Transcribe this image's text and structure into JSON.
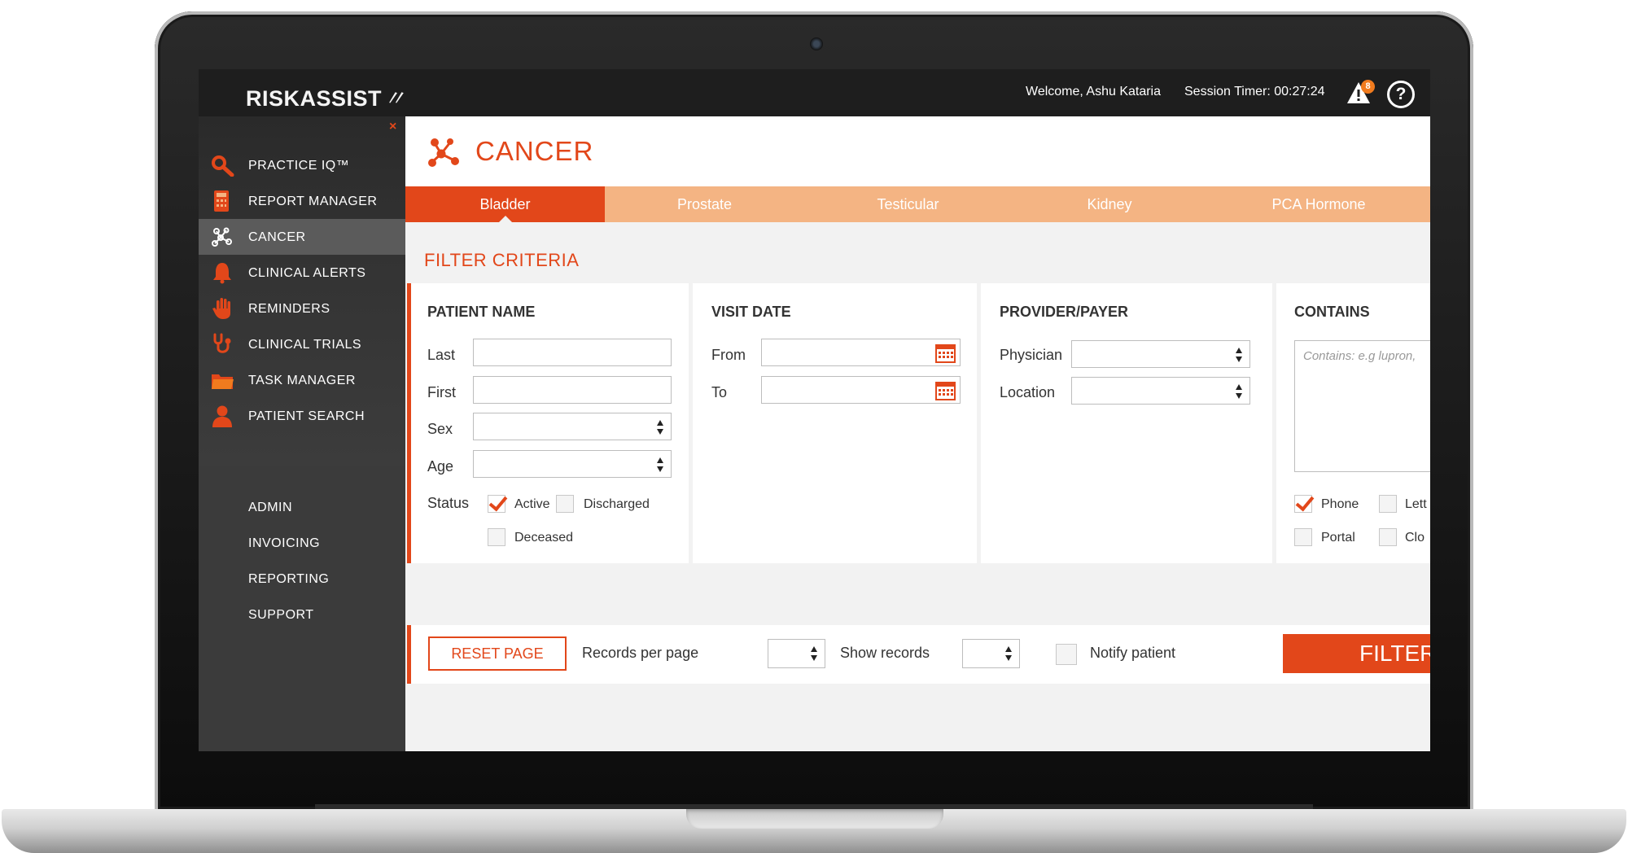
{
  "app": {
    "logo_text": "RISKASSIST",
    "welcome_text": "Welcome,  Ashu Kataria",
    "session_timer": "Session Timer: 00:27:24",
    "alert_count": "8",
    "help_glyph": "?",
    "close_glyph": "×"
  },
  "sidebar": {
    "items": [
      {
        "label": "PRACTICE IQ™",
        "icon": "magnifier-icon"
      },
      {
        "label": "REPORT MANAGER",
        "icon": "calculator-icon"
      },
      {
        "label": "CANCER",
        "icon": "molecule-icon",
        "active": true
      },
      {
        "label": "CLINICAL ALERTS",
        "icon": "bell-icon"
      },
      {
        "label": "REMINDERS",
        "icon": "hand-icon"
      },
      {
        "label": "CLINICAL TRIALS",
        "icon": "stethoscope-icon"
      },
      {
        "label": "TASK MANAGER",
        "icon": "folder-icon"
      },
      {
        "label": "PATIENT SEARCH",
        "icon": "person-icon"
      }
    ],
    "admin_items": [
      "ADMIN",
      "INVOICING",
      "REPORTING",
      "SUPPORT"
    ]
  },
  "page": {
    "title": "CANCER",
    "tabs": [
      {
        "label": "Bladder",
        "active": true
      },
      {
        "label": "Prostate"
      },
      {
        "label": "Testicular"
      },
      {
        "label": "Kidney"
      },
      {
        "label": "PCA Hormone"
      }
    ],
    "filter_title": "FILTER CRITERIA"
  },
  "filters": {
    "patient_name": {
      "heading": "PATIENT NAME",
      "last_label": "Last",
      "last_value": "",
      "first_label": "First",
      "first_value": "",
      "sex_label": "Sex",
      "sex_value": "",
      "age_label": "Age",
      "age_value": "",
      "status_label": "Status",
      "status_options": [
        {
          "label": "Active",
          "checked": true
        },
        {
          "label": "Discharged",
          "checked": false
        },
        {
          "label": "Deceased",
          "checked": false
        }
      ]
    },
    "visit_date": {
      "heading": "VISIT DATE",
      "from_label": "From",
      "from_value": "",
      "to_label": "To",
      "to_value": ""
    },
    "provider_payer": {
      "heading": "PROVIDER/PAYER",
      "physician_label": "Physician",
      "physician_value": "",
      "location_label": "Location",
      "location_value": ""
    },
    "contains": {
      "heading": "CONTAINS",
      "placeholder": "Contains: e.g lupron,",
      "options": [
        {
          "label": "Phone",
          "checked": true
        },
        {
          "label": "Lett",
          "checked": false
        },
        {
          "label": "Portal",
          "checked": false
        },
        {
          "label": "Clo",
          "checked": false
        }
      ]
    }
  },
  "actions": {
    "reset_label": "RESET PAGE",
    "records_per_page_label": "Records per page",
    "show_records_label": "Show records",
    "notify_label": "Notify patient",
    "notify_checked": false,
    "filter_label": "FILTER"
  },
  "colors": {
    "accent": "#e2471a",
    "tab_bar": "#f4b483",
    "topbar": "#1e1e1e",
    "sidebar": "#3b3b3b"
  }
}
